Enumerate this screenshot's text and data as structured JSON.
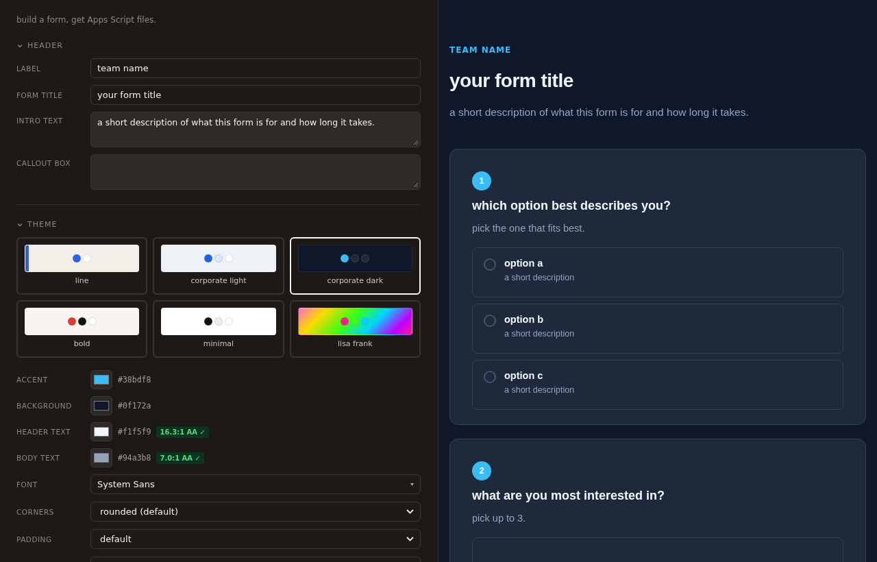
{
  "editor": {
    "tagline": "build a form, get Apps Script files.",
    "header_section": {
      "title": "HEADER",
      "expanded": true,
      "fields": [
        {
          "kind": "input",
          "label": "LABEL",
          "value": "team name"
        },
        {
          "kind": "input",
          "label": "FORM TITLE",
          "value": "your form title"
        },
        {
          "kind": "textarea",
          "label": "INTRO TEXT",
          "value": "a short description of what this form is for and how long it takes."
        },
        {
          "kind": "textarea",
          "label": "CALLOUT BOX"
        }
      ]
    },
    "theme_section": {
      "title": "THEME",
      "expanded": true,
      "themes": [
        {
          "name": "line",
          "kind": "bar",
          "selected": false,
          "color": "#f3efe8",
          "dots": [
            {
              "color": "#2563eb"
            },
            {
              "color": "#ffffff"
            }
          ]
        },
        {
          "name": "corporate light",
          "kind": "plain",
          "selected": false,
          "color": "#eef2f7",
          "dots": [
            {
              "color": "#1d63ed"
            },
            {
              "color": "#dbe8fe"
            },
            {
              "color": "#ffffff"
            }
          ]
        },
        {
          "name": "corporate dark",
          "kind": "plain",
          "selected": true,
          "color": "#0f172a",
          "dots": [
            {
              "color": "#38bdf8"
            },
            {
              "color": "#1e293b"
            },
            {
              "color": "#1e293b"
            }
          ]
        },
        {
          "name": "bold",
          "kind": "plain",
          "selected": false,
          "color": "#f8f4ef",
          "dots": [
            {
              "color": "#e03a33"
            },
            {
              "color": "#111111"
            },
            {
              "color": "#ffffff"
            }
          ]
        },
        {
          "name": "minimal",
          "kind": "plain",
          "selected": false,
          "color": "#ffffff",
          "dots": [
            {
              "color": "#111111"
            },
            {
              "color": "#eeeeee"
            },
            {
              "color": "#ffffff"
            }
          ]
        },
        {
          "name": "lisa frank",
          "kind": "gradient",
          "selected": false,
          "dots": [
            {
              "color": "#ff1a8c"
            },
            {
              "color": "#39ff14"
            },
            {
              "color": "#00d4ff"
            }
          ]
        }
      ],
      "colors": [
        {
          "label": "ACCENT",
          "color": "#38bdf8",
          "hex": "#38bdf8"
        },
        {
          "label": "BACKGROUND",
          "color": "#0f172a",
          "hex": "#0f172a"
        },
        {
          "label": "HEADER TEXT",
          "color": "#f1f5f9",
          "hex": "#f1f5f9",
          "contrast": "16.3:1 AA ✓"
        },
        {
          "label": "BODY TEXT",
          "color": "#94a3b8",
          "hex": "#94a3b8",
          "contrast": "7.0:1 AA ✓"
        }
      ],
      "selects": [
        {
          "kind": "custom",
          "label": "FONT",
          "value": "System Sans"
        },
        {
          "kind": "native",
          "label": "CORNERS",
          "value": "rounded (default)"
        },
        {
          "kind": "native",
          "label": "PADDING",
          "value": "default"
        },
        {
          "kind": "blank"
        }
      ]
    }
  },
  "preview": {
    "label": "TEAM NAME",
    "title": "your form title",
    "intro": "a short description of what this form is for and how long it takes.",
    "questions": [
      {
        "number": "1",
        "title": "which option best describes you?",
        "hint": "pick the one that fits best.",
        "options": [
          {
            "label": "option a",
            "description": "a short description",
            "selected": false
          },
          {
            "label": "option b",
            "description": "a short description",
            "selected": false
          },
          {
            "label": "option c",
            "description": "a short description",
            "selected": false
          }
        ]
      },
      {
        "number": "2",
        "title": "what are you most interested in?",
        "hint": "pick up to 3.",
        "options": [
          {
            "kind": "blank"
          }
        ]
      }
    ]
  }
}
